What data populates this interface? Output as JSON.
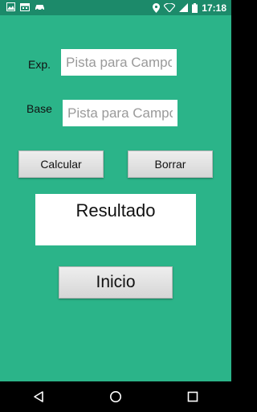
{
  "status_bar": {
    "time": "17:18",
    "left_icons": [
      "image-icon",
      "calendar-icon",
      "car-icon"
    ],
    "right_icons": [
      "location-icon",
      "wifi-icon",
      "signal-icon",
      "battery-icon"
    ]
  },
  "form": {
    "exp_label": "Exp.",
    "exp_placeholder": "Pista para Campo",
    "base_label": "Base",
    "base_placeholder": "Pista para Campo"
  },
  "buttons": {
    "calcular": "Calcular",
    "borrar": "Borrar",
    "inicio": "Inicio"
  },
  "result": {
    "text": "Resultado"
  },
  "colors": {
    "app_background": "#2bb489",
    "status_bar": "#1c8a6a",
    "nav_bar": "#000000"
  }
}
